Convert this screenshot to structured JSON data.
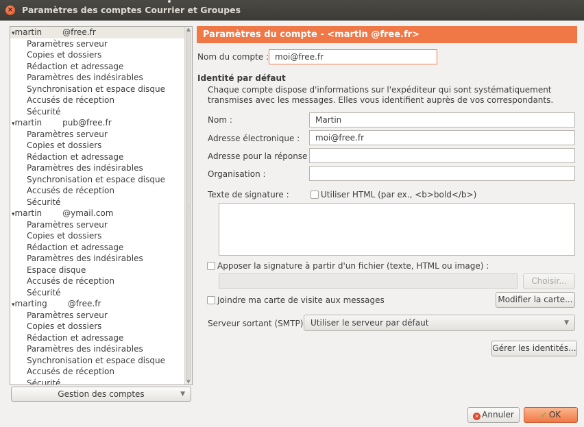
{
  "window": {
    "title": "Paramètres des comptes Courrier et Groupes"
  },
  "tree": {
    "accounts": [
      {
        "name": "martin",
        "domain": "@free.fr",
        "items": [
          "Paramètres serveur",
          "Copies et dossiers",
          "Rédaction et adressage",
          "Paramètres des indésirables",
          "Synchronisation et espace disque",
          "Accusés de réception",
          "Sécurité"
        ]
      },
      {
        "name": "martin",
        "domain": "pub@free.fr",
        "items": [
          "Paramètres serveur",
          "Copies et dossiers",
          "Rédaction et adressage",
          "Paramètres des indésirables",
          "Synchronisation et espace disque",
          "Accusés de réception",
          "Sécurité"
        ]
      },
      {
        "name": "martin",
        "domain": "@ymail.com",
        "items": [
          "Paramètres serveur",
          "Copies et dossiers",
          "Rédaction et adressage",
          "Paramètres des indésirables",
          "Espace disque",
          "Accusés de réception",
          "Sécurité"
        ]
      },
      {
        "name": "marting",
        "domain": "@free.fr",
        "items": [
          "Paramètres serveur",
          "Copies et dossiers",
          "Rédaction et adressage",
          "Paramètres des indésirables",
          "Synchronisation et espace disque",
          "Accusés de réception",
          "Sécurité"
        ]
      }
    ],
    "manage_button": "Gestion des comptes"
  },
  "panel": {
    "header": "Paramètres du compte - <martin          @free.fr>",
    "account_name_label": "Nom du compte :",
    "account_name_value": "moi@free.fr",
    "identity_heading": "Identité par défaut",
    "identity_desc": "Chaque compte dispose d'informations sur l'expéditeur qui sont systématiquement transmises avec les messages. Elles vous identifient auprès de vos correspondants.",
    "name_label": "Nom :",
    "name_value": "Martin",
    "email_label": "Adresse électronique :",
    "email_value": "moi@free.fr",
    "reply_label": "Adresse pour la réponse :",
    "reply_value": "",
    "org_label": "Organisation :",
    "org_value": "",
    "signature_label": "Texte de signature :",
    "use_html_label": "Utiliser HTML (par ex., <b>bold</b>)",
    "signature_value": "",
    "sig_file_label": "Apposer la signature à partir d'un fichier (texte, HTML ou image) :",
    "choose_button": "Choisir...",
    "vcard_label": "Joindre ma carte de visite aux messages",
    "modify_card_button": "Modifier la carte...",
    "smtp_label": "Serveur sortant (SMTP) :",
    "smtp_value": "Utiliser le serveur par défaut",
    "manage_identities_button": "Gérer les identités..."
  },
  "footer": {
    "cancel": "Annuler",
    "ok": "OK"
  },
  "colors": {
    "accent": "#f07746",
    "titlebar": "#3c3b37"
  }
}
